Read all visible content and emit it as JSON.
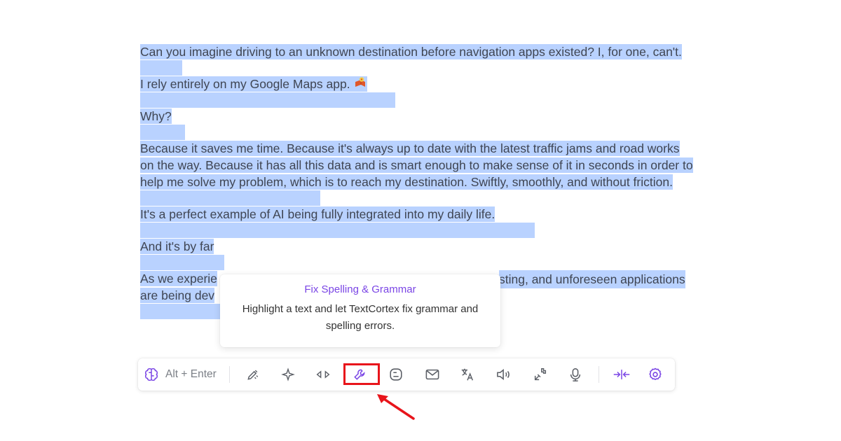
{
  "editor": {
    "paragraphs": [
      "Can you imagine driving to an unknown destination before navigation apps existed? I, for one, can't.",
      "I rely entirely on my Google Maps app.",
      "Why?",
      "Because it saves me time. Because it's always up to date with the latest traffic jams and road works on the way. Because it has all this data and is smart enough to make sense of it in seconds in order to help me solve my problem, which is to reach my destination. Swiftly, smoothly, and without friction.",
      "It's a perfect example of AI being fully integrated into my daily life.",
      "And it's by far",
      "As we experie",
      "sting, and unforeseen applications",
      "are being dev"
    ]
  },
  "tooltip": {
    "title": "Fix Spelling & Grammar",
    "description": "Highlight a text and let TextCortex fix grammar and spelling errors."
  },
  "toolbar": {
    "shortcut_label": "Alt + Enter",
    "accent_color": "#7a45e5",
    "icon_color": "#5b5f66",
    "highlight_color": "#e8141b",
    "icons": [
      "brain-icon",
      "pen-nib-icon",
      "sparkle-icon",
      "arrows-expand-icon",
      "wrench-icon",
      "blog-icon",
      "mail-icon",
      "translate-icon",
      "speaker-icon",
      "puzzle-icon",
      "microphone-icon",
      "collapse-icon",
      "settings-icon"
    ]
  }
}
